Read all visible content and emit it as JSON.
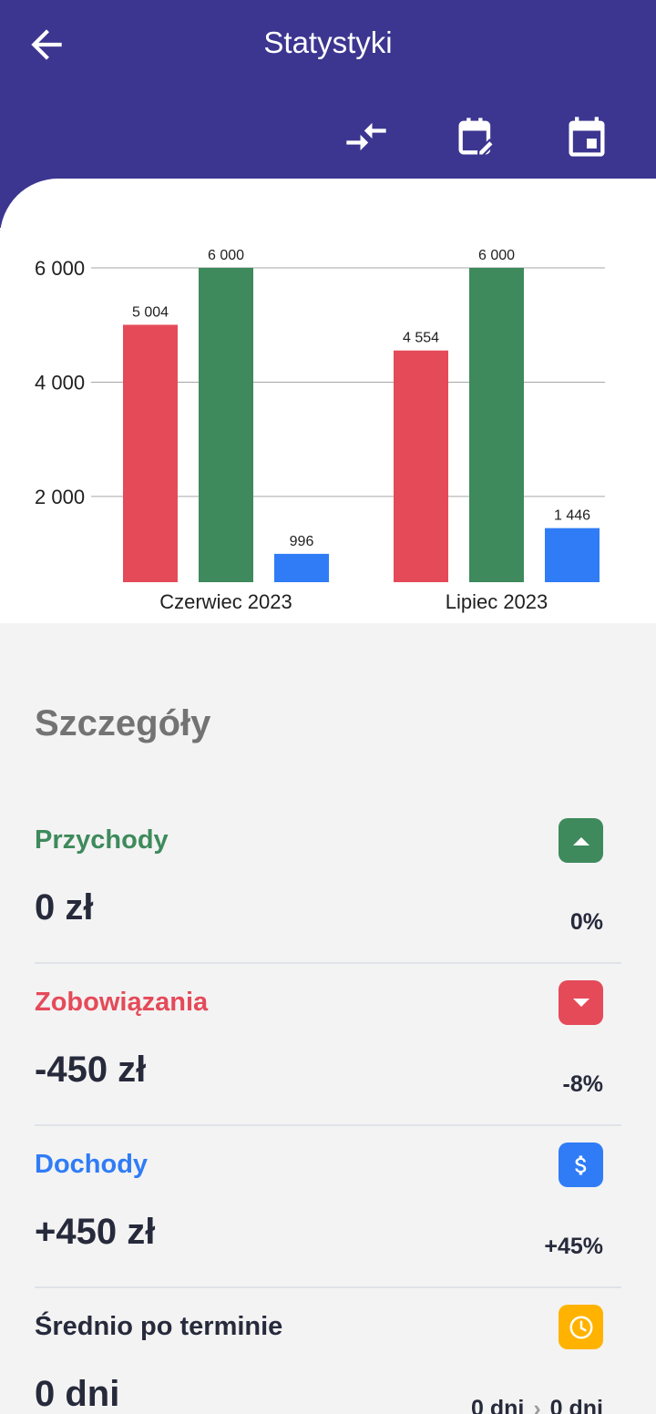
{
  "header": {
    "title": "Statystyki",
    "color": "#3c3690"
  },
  "chart_data": {
    "type": "bar",
    "categories": [
      "Czerwiec 2023",
      "Lipiec 2023"
    ],
    "series": [
      {
        "color": "#e54a59",
        "values": [
          5004,
          4554
        ],
        "labels": [
          "5 004",
          "4 554"
        ]
      },
      {
        "color": "#3e8a5c",
        "values": [
          6000,
          6000
        ],
        "labels": [
          "6 000",
          "6 000"
        ]
      },
      {
        "color": "#2f7cf6",
        "values": [
          996,
          1446
        ],
        "labels": [
          "996",
          "1 446"
        ]
      }
    ],
    "ylim": [
      500,
      6000
    ],
    "yticks": [
      2000,
      4000,
      6000
    ],
    "ytick_labels": [
      "2 000",
      "4 000",
      "6 000"
    ],
    "grid": true
  },
  "details": {
    "title": "Szczegóły",
    "rows": [
      {
        "label": "Przychody",
        "value": "0 zł",
        "pct": "0%",
        "icon": "caret-up-icon",
        "color": "#3e8a5c"
      },
      {
        "label": "Zobowiązania",
        "value": "-450 zł",
        "pct": "-8%",
        "icon": "caret-down-icon",
        "color": "#e54a59"
      },
      {
        "label": "Dochody",
        "value": "+450 zł",
        "pct": "+45%",
        "icon": "dollar-icon",
        "color": "#2f7cf6"
      },
      {
        "label": "Średnio po terminie",
        "value": "0 dni",
        "from": "0 dni",
        "to": "0 dni",
        "icon": "clock-icon",
        "color": "#ffb300"
      }
    ]
  }
}
